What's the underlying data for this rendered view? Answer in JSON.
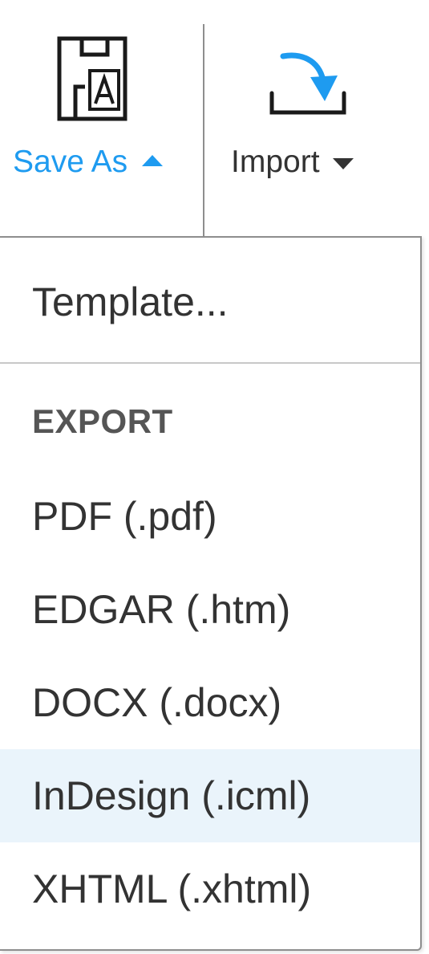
{
  "toolbar": {
    "save_as": {
      "label": "Save As",
      "icon": "save-as-template-icon",
      "state": "open"
    },
    "import": {
      "label": "Import",
      "icon": "import-tray-arrow-icon"
    }
  },
  "menu": {
    "template_item": "Template...",
    "export_header": "EXPORT",
    "export_items": [
      "PDF (.pdf)",
      "EDGAR (.htm)",
      "DOCX (.docx)",
      "InDesign (.icml)",
      "XHTML (.xhtml)"
    ],
    "highlighted_item": "InDesign (.icml)"
  },
  "colors": {
    "accent": "#1e9bf0",
    "text": "#333333",
    "header_text": "#555555",
    "highlight_bg": "#eaf4fb",
    "border": "#8e8e8e"
  }
}
